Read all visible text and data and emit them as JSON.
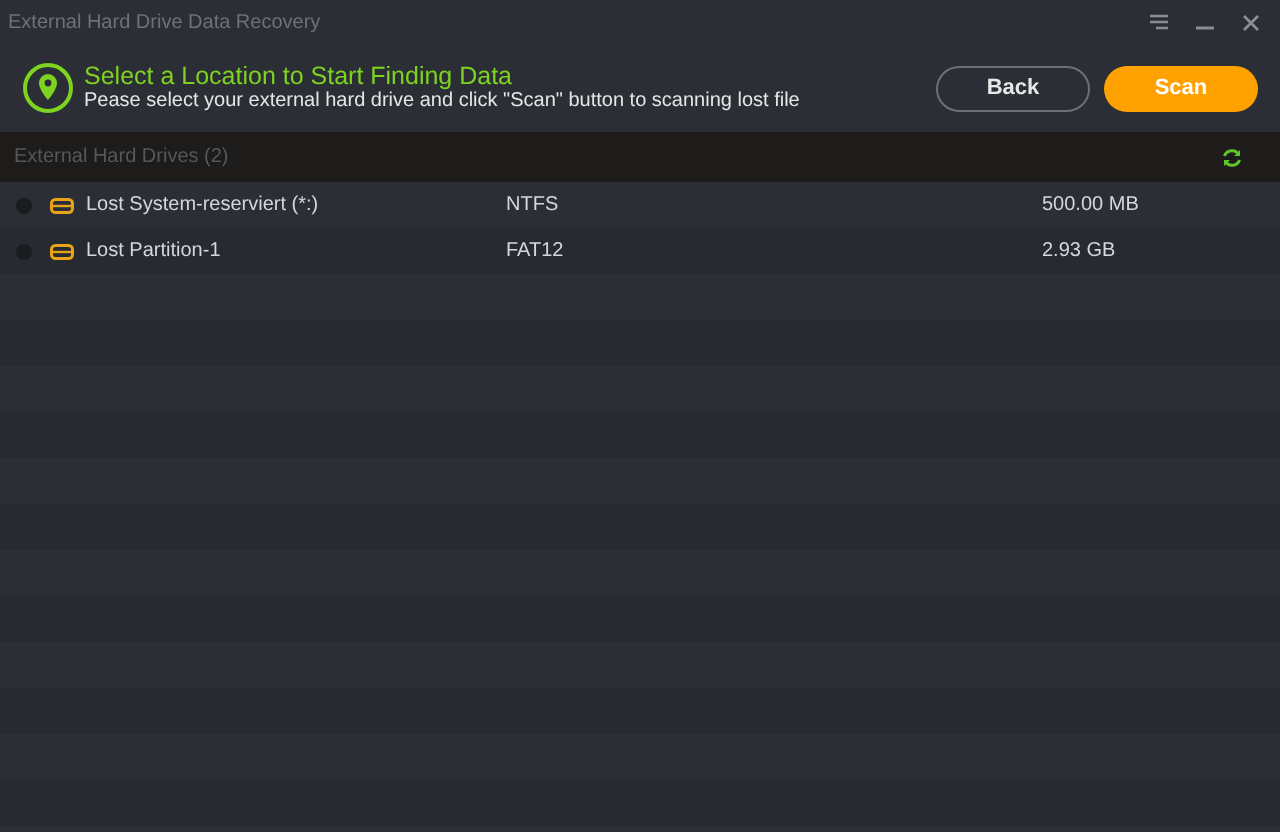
{
  "window": {
    "title": "External Hard Drive Data Recovery"
  },
  "header": {
    "title": "Select a Location to Start Finding Data",
    "subtitle": "Pease select your external hard drive  and click \"Scan\" button to scanning lost file"
  },
  "buttons": [
    {
      "label": "Back",
      "kind": "secondary"
    },
    {
      "label": "Scan",
      "kind": "primary"
    }
  ],
  "section": {
    "title": "External Hard Drives (2)"
  },
  "drives": [
    {
      "name": "Lost System-reserviert (*:)",
      "filesystem": "NTFS",
      "size": "500.00 MB",
      "selected": false
    },
    {
      "name": "Lost Partition-1",
      "filesystem": "FAT12",
      "size": "2.93 GB",
      "selected": false
    }
  ]
}
